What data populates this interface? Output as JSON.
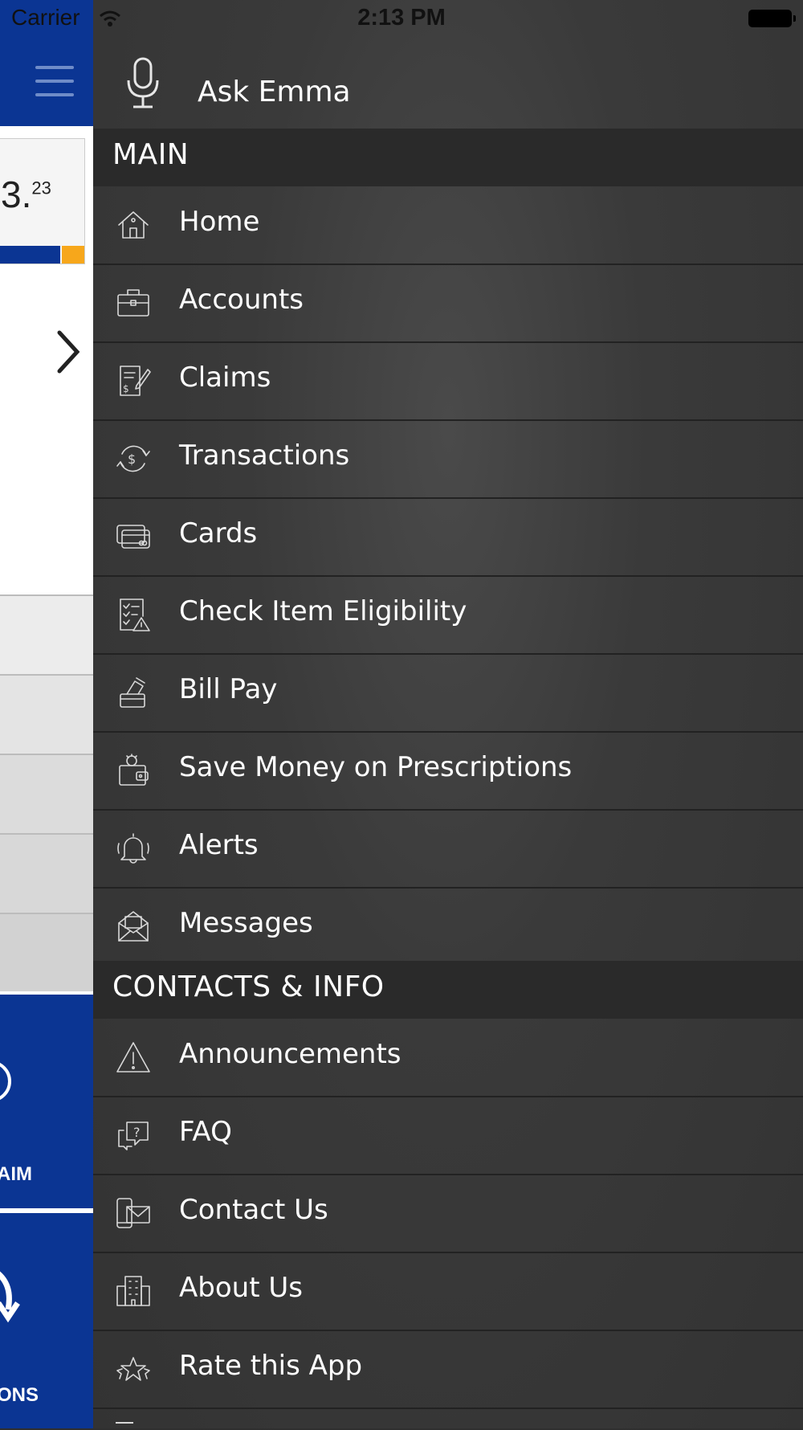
{
  "status_bar": {
    "carrier": "Carrier",
    "time": "2:13 PM"
  },
  "background_screen": {
    "balance_main": "3.",
    "balance_cents": "23",
    "tile_labels": [
      "AIM",
      "ONS"
    ],
    "colors": {
      "header": "#0b3593",
      "accent": "#f7a71b"
    }
  },
  "drawer": {
    "ask": {
      "label": "Ask Emma",
      "icon": "microphone-icon"
    },
    "sections": [
      {
        "title": "MAIN",
        "items": [
          {
            "label": "Home",
            "icon": "home-icon"
          },
          {
            "label": "Accounts",
            "icon": "briefcase-icon"
          },
          {
            "label": "Claims",
            "icon": "claim-form-icon"
          },
          {
            "label": "Transactions",
            "icon": "dollar-cycle-icon"
          },
          {
            "label": "Cards",
            "icon": "cards-icon"
          },
          {
            "label": "Check Item Eligibility",
            "icon": "checklist-warning-icon"
          },
          {
            "label": "Bill Pay",
            "icon": "bill-pay-icon"
          },
          {
            "label": "Save Money on Prescriptions",
            "icon": "prescription-wallet-icon"
          },
          {
            "label": "Alerts",
            "icon": "bell-icon"
          },
          {
            "label": "Messages",
            "icon": "envelope-open-icon"
          }
        ]
      },
      {
        "title": "CONTACTS & INFO",
        "items": [
          {
            "label": "Announcements",
            "icon": "warning-triangle-icon"
          },
          {
            "label": "FAQ",
            "icon": "faq-chat-icon"
          },
          {
            "label": "Contact Us",
            "icon": "phone-mail-icon"
          },
          {
            "label": "About Us",
            "icon": "building-icon"
          },
          {
            "label": "Rate this App",
            "icon": "stars-icon"
          }
        ]
      }
    ]
  }
}
